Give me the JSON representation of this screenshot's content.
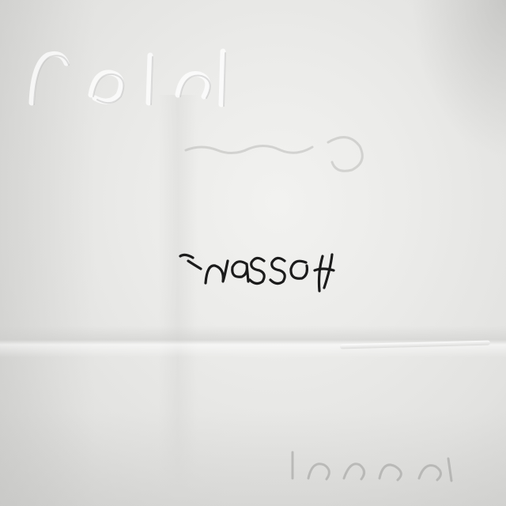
{
  "photo": {
    "description_kind": "photograph of folded white paper with handwritten word",
    "handwriting": "Hassan",
    "handwriting_orientation": "upside-down",
    "paper_color": "#ecece9",
    "ink_color": "#1b1b1b"
  }
}
